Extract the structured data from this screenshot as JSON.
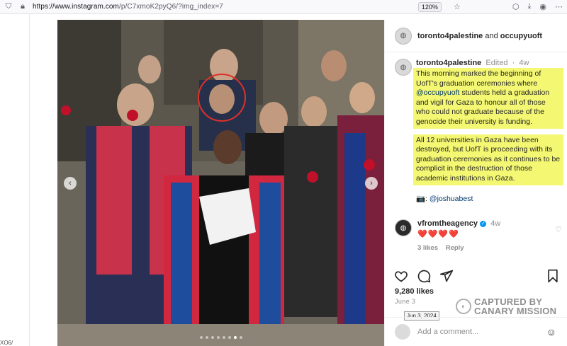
{
  "browser": {
    "url_host": "https://www.instagram.com",
    "url_path": "/p/C7xmoK2pyQ6/?img_index=7",
    "zoom": "120%"
  },
  "gutter": {
    "text": "ΧΟ6/"
  },
  "post": {
    "header": {
      "account": "toronto4palestine",
      "joiner": "and",
      "collaborator": "occupyuoft"
    },
    "caption": {
      "author": "toronto4palestine",
      "edited": "Edited",
      "separator": "·",
      "age": "4w",
      "para1_a": "This morning marked the beginning of UofT's graduation ceremonies where ",
      "para1_mention": "@occupyuoft",
      "para1_b": " students held a graduation and vigil for Gaza to honour all of those who could not graduate because of the genocide their university is funding.",
      "para2": "All 12 universities in Gaza have been destroyed, but UofT is proceeding with its graduation ceremonies as it continues to be complicit in the destruction of those academic institutions in Gaza.",
      "credit_icon": "📷",
      "credit_sep": ":",
      "credit_mention": "@joshuabest"
    },
    "comment": {
      "author": "vfromtheagency",
      "verified_glyph": "✓",
      "age": "4w",
      "hearts": "❤️❤️❤️❤️",
      "likes": "3 likes",
      "reply": "Reply"
    },
    "likes": "9,280 likes",
    "date": "June 3",
    "date_tooltip": "Jun 3, 2024",
    "add_comment_placeholder": "Add a comment...",
    "carousel": {
      "count": 8,
      "active_index": 6
    }
  },
  "watermark": {
    "line1": "CAPTURED BY",
    "line2": "CANARY MISSION"
  },
  "colors": {
    "highlight": "#f4f772",
    "mention": "#00376b",
    "heart": "#ed4956",
    "annotation_circle": "#e0302a"
  }
}
